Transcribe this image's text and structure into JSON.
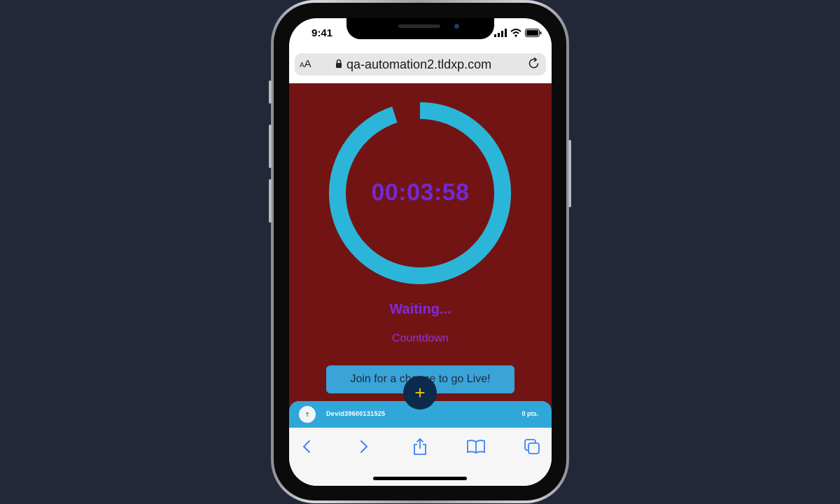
{
  "status_bar": {
    "time": "9:41"
  },
  "browser": {
    "text_size_label_small": "A",
    "text_size_label_large": "A",
    "url": "qa-automation2.tldxp.com"
  },
  "timer": {
    "display": "00:03:58",
    "progress_fraction": 0.95
  },
  "status": {
    "title": "Waiting...",
    "subtitle": "Countdown"
  },
  "join_button": {
    "label": "Join for a chance to go Live!"
  },
  "fab": {
    "symbol": "+"
  },
  "user_bar": {
    "username": "Devid39600131525",
    "points": "0 pts."
  },
  "colors": {
    "content_bg": "#731414",
    "ring": "#2bb6d9",
    "timer_text": "#6f2bd3",
    "join_button_bg": "#3aa3d8",
    "user_bar_bg": "#2fa8d9",
    "fab_bg": "#0c2a4d",
    "fab_symbol": "#f5c400",
    "toolbar_icon": "#3b82f6"
  },
  "toolbar": {
    "icons": [
      "back-icon",
      "forward-icon",
      "share-icon",
      "bookmarks-icon",
      "tabs-icon"
    ]
  }
}
